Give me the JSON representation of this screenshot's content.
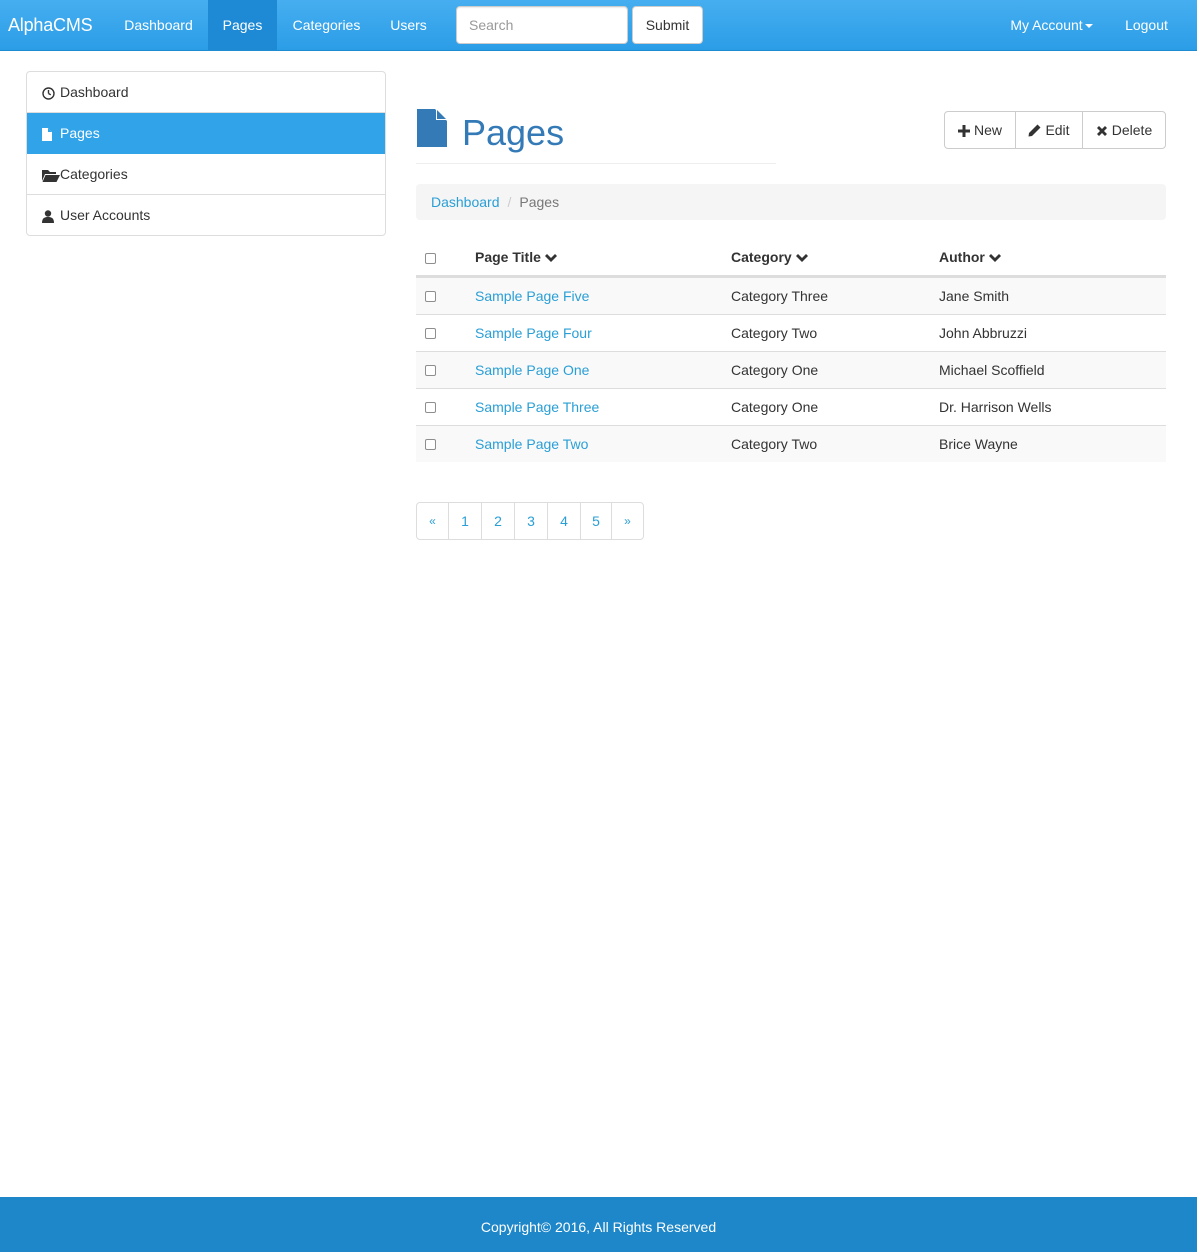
{
  "navbar": {
    "brand": "AlphaCMS",
    "links": [
      {
        "label": "Dashboard",
        "active": false
      },
      {
        "label": "Pages",
        "active": true
      },
      {
        "label": "Categories",
        "active": false
      },
      {
        "label": "Users",
        "active": false
      }
    ],
    "search_placeholder": "Search",
    "submit_label": "Submit",
    "account_label": "My Account",
    "logout_label": "Logout"
  },
  "sidebar": {
    "items": [
      {
        "label": "Dashboard",
        "icon": "dashboard-icon",
        "active": false
      },
      {
        "label": "Pages",
        "icon": "file-icon",
        "active": true
      },
      {
        "label": "Categories",
        "icon": "folder-open-icon",
        "active": false
      },
      {
        "label": "User Accounts",
        "icon": "user-icon",
        "active": false
      }
    ]
  },
  "main": {
    "title": "Pages",
    "title_icon": "file-icon",
    "actions": {
      "new_label": "New",
      "edit_label": "Edit",
      "delete_label": "Delete"
    },
    "breadcrumb": {
      "home": "Dashboard",
      "current": "Pages"
    },
    "table": {
      "columns": [
        "Page Title",
        "Category",
        "Author"
      ],
      "rows": [
        {
          "title": "Sample Page Five",
          "category": "Category Three",
          "author": "Jane Smith"
        },
        {
          "title": "Sample Page Four",
          "category": "Category Two",
          "author": "John Abbruzzi"
        },
        {
          "title": "Sample Page One",
          "category": "Category One",
          "author": "Michael Scoffield"
        },
        {
          "title": "Sample Page Three",
          "category": "Category One",
          "author": "Dr. Harrison Wells"
        },
        {
          "title": "Sample Page Two",
          "category": "Category Two",
          "author": "Brice Wayne"
        }
      ]
    },
    "pagination": {
      "prev": "«",
      "pages": [
        "1",
        "2",
        "3",
        "4",
        "5"
      ],
      "next": "»"
    }
  },
  "footer": {
    "text": "Copyright© 2016, All Rights Reserved"
  },
  "colors": {
    "primary": "#2b9de7",
    "link": "#2a9fd6",
    "title": "#337ab7",
    "footer": "#1d87c9"
  }
}
